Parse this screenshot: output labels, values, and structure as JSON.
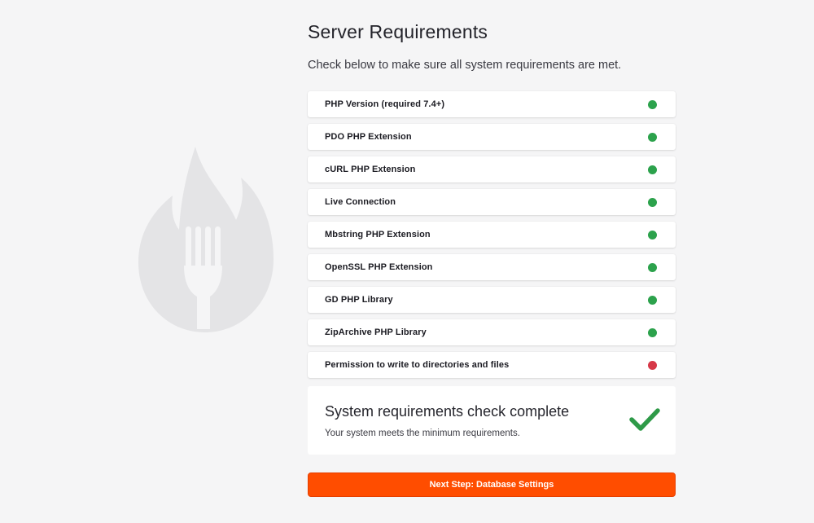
{
  "page": {
    "title": "Server Requirements",
    "subtitle": "Check below to make sure all system requirements are met."
  },
  "requirements": [
    {
      "label": "PHP Version (required 7.4+)",
      "status": "pass"
    },
    {
      "label": "PDO PHP Extension",
      "status": "pass"
    },
    {
      "label": "cURL PHP Extension",
      "status": "pass"
    },
    {
      "label": "Live Connection",
      "status": "pass"
    },
    {
      "label": "Mbstring PHP Extension",
      "status": "pass"
    },
    {
      "label": "OpenSSL PHP Extension",
      "status": "pass"
    },
    {
      "label": "GD PHP Library",
      "status": "pass"
    },
    {
      "label": "ZipArchive PHP Library",
      "status": "pass"
    },
    {
      "label": "Permission to write to directories and files",
      "status": "fail"
    }
  ],
  "summary": {
    "title": "System requirements check complete",
    "text": "Your system meets the minimum requirements.",
    "icon": "checkmark-icon"
  },
  "actions": {
    "next_label": "Next Step: Database Settings"
  },
  "colors": {
    "pass": "#2ca24c",
    "fail": "#d63847",
    "accent": "#ff4d00",
    "check": "#2e9a48",
    "logo": "#e4e4e6"
  },
  "icons": {
    "logo": "flame-fork-logo-icon",
    "status": "status-dot-icon"
  }
}
